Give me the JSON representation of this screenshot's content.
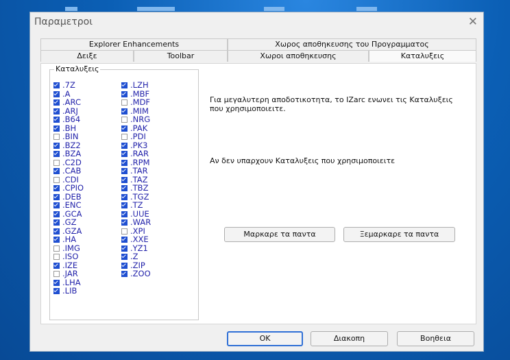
{
  "window": {
    "title": "Παραμετροι"
  },
  "tabs_top": [
    "Explorer Enhancements",
    "Χωρος αποθηκευσης του Προγραμματος"
  ],
  "tabs_bottom": [
    "Δειξε",
    "Toolbar",
    "Χωροι αποθηκευσης",
    "Καταλυξεις"
  ],
  "active_tab": "Καταλυξεις",
  "group": {
    "label": "Καταλυξεις"
  },
  "extensions_col1": [
    {
      "ext": ".7Z",
      "checked": true
    },
    {
      "ext": ".A",
      "checked": true
    },
    {
      "ext": ".ARC",
      "checked": true
    },
    {
      "ext": ".ARJ",
      "checked": true
    },
    {
      "ext": ".B64",
      "checked": true
    },
    {
      "ext": ".BH",
      "checked": true
    },
    {
      "ext": ".BIN",
      "checked": false
    },
    {
      "ext": ".BZ2",
      "checked": true
    },
    {
      "ext": ".BZA",
      "checked": true
    },
    {
      "ext": ".C2D",
      "checked": false
    },
    {
      "ext": ".CAB",
      "checked": true
    },
    {
      "ext": ".CDI",
      "checked": false
    },
    {
      "ext": ".CPIO",
      "checked": true
    },
    {
      "ext": ".DEB",
      "checked": true
    },
    {
      "ext": ".ENC",
      "checked": true
    },
    {
      "ext": ".GCA",
      "checked": true
    },
    {
      "ext": ".GZ",
      "checked": true
    },
    {
      "ext": ".GZA",
      "checked": true
    },
    {
      "ext": ".HA",
      "checked": true
    },
    {
      "ext": ".IMG",
      "checked": false
    },
    {
      "ext": ".ISO",
      "checked": false
    },
    {
      "ext": ".IZE",
      "checked": true
    },
    {
      "ext": ".JAR",
      "checked": false
    },
    {
      "ext": ".LHA",
      "checked": true
    },
    {
      "ext": ".LIB",
      "checked": true
    }
  ],
  "extensions_col2": [
    {
      "ext": ".LZH",
      "checked": true
    },
    {
      "ext": ".MBF",
      "checked": true
    },
    {
      "ext": ".MDF",
      "checked": false
    },
    {
      "ext": ".MIM",
      "checked": true
    },
    {
      "ext": ".NRG",
      "checked": false
    },
    {
      "ext": ".PAK",
      "checked": true
    },
    {
      "ext": ".PDI",
      "checked": false
    },
    {
      "ext": ".PK3",
      "checked": true
    },
    {
      "ext": ".RAR",
      "checked": true
    },
    {
      "ext": ".RPM",
      "checked": true
    },
    {
      "ext": ".TAR",
      "checked": true
    },
    {
      "ext": ".TAZ",
      "checked": true
    },
    {
      "ext": ".TBZ",
      "checked": true
    },
    {
      "ext": ".TGZ",
      "checked": true
    },
    {
      "ext": ".TZ",
      "checked": true
    },
    {
      "ext": ".UUE",
      "checked": true
    },
    {
      "ext": ".WAR",
      "checked": true
    },
    {
      "ext": ".XPI",
      "checked": false
    },
    {
      "ext": ".XXE",
      "checked": true
    },
    {
      "ext": ".YZ1",
      "checked": true
    },
    {
      "ext": ".Z",
      "checked": true
    },
    {
      "ext": ".ZIP",
      "checked": true
    },
    {
      "ext": ".ZOO",
      "checked": true
    }
  ],
  "info": {
    "line1": "Για μεγαλυτερη αποδοτικοτητα, το IZarc ενωνει τις Καταλυξεις",
    "line2": "που χρησιμοποιειτε.",
    "line3": "Αν δεν υπαρχουν Καταλυξεις που χρησιμοποιειτε"
  },
  "buttons": {
    "check_all": "Μαρκαρε τα παντα",
    "uncheck_all": "Ξεμαρκαρε τα παντα",
    "ok": "OK",
    "cancel": "Διακοπη",
    "help": "Βοηθεια"
  },
  "colors": {
    "accent": "#1f4fd1",
    "ext_text": "#2222aa",
    "desktop": "#0b5fb5"
  }
}
